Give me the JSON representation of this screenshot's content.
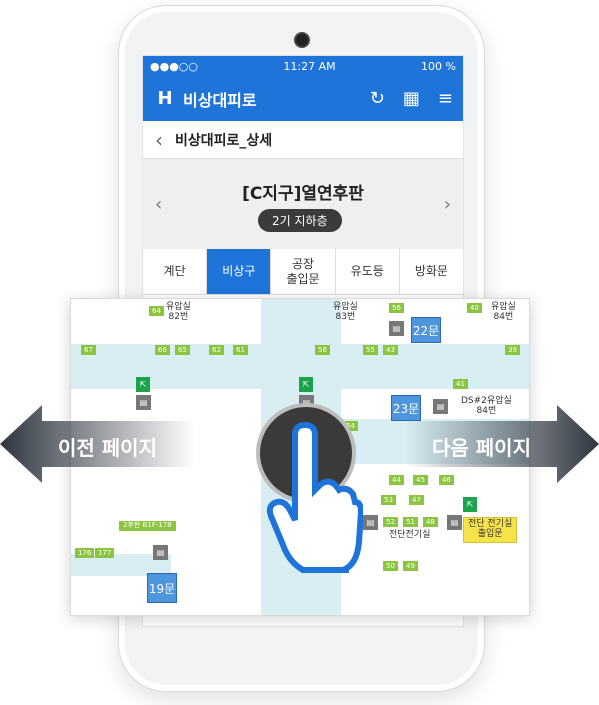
{
  "status": {
    "signal": "●●●○○",
    "time": "11:27 AM",
    "battery": "100 %"
  },
  "app": {
    "title": "비상대피로"
  },
  "subheader": {
    "title": "비상대피로_상세"
  },
  "panel": {
    "building": "[C지구]열연후판",
    "floor": "2기 지하층"
  },
  "tabs": [
    {
      "label": "계단"
    },
    {
      "label": "비상구"
    },
    {
      "label": "공장\n출입문"
    },
    {
      "label": "유도등"
    },
    {
      "label": "방화문"
    }
  ],
  "map": {
    "rooms": [
      "유압실\n82번",
      "유압실\n83번",
      "유압실\n84번",
      "DS#2유압실\n84번",
      "전단전기실",
      "2후판 B1F-178"
    ],
    "doors": [
      "22문",
      "23문",
      "19문"
    ],
    "callout": "전단 전기실\n출입문",
    "tags": [
      "64",
      "56",
      "40",
      "67",
      "66",
      "65",
      "62",
      "61",
      "58",
      "55",
      "43",
      "39",
      "41",
      "54",
      "44",
      "45",
      "46",
      "53",
      "47",
      "52",
      "51",
      "48",
      "50",
      "49",
      "176",
      "177"
    ]
  },
  "overlay": {
    "prev": "이전 페이지",
    "next": "다음 페이지"
  },
  "colors": {
    "accent": "#1f74d9",
    "green": "#8bc53f"
  }
}
